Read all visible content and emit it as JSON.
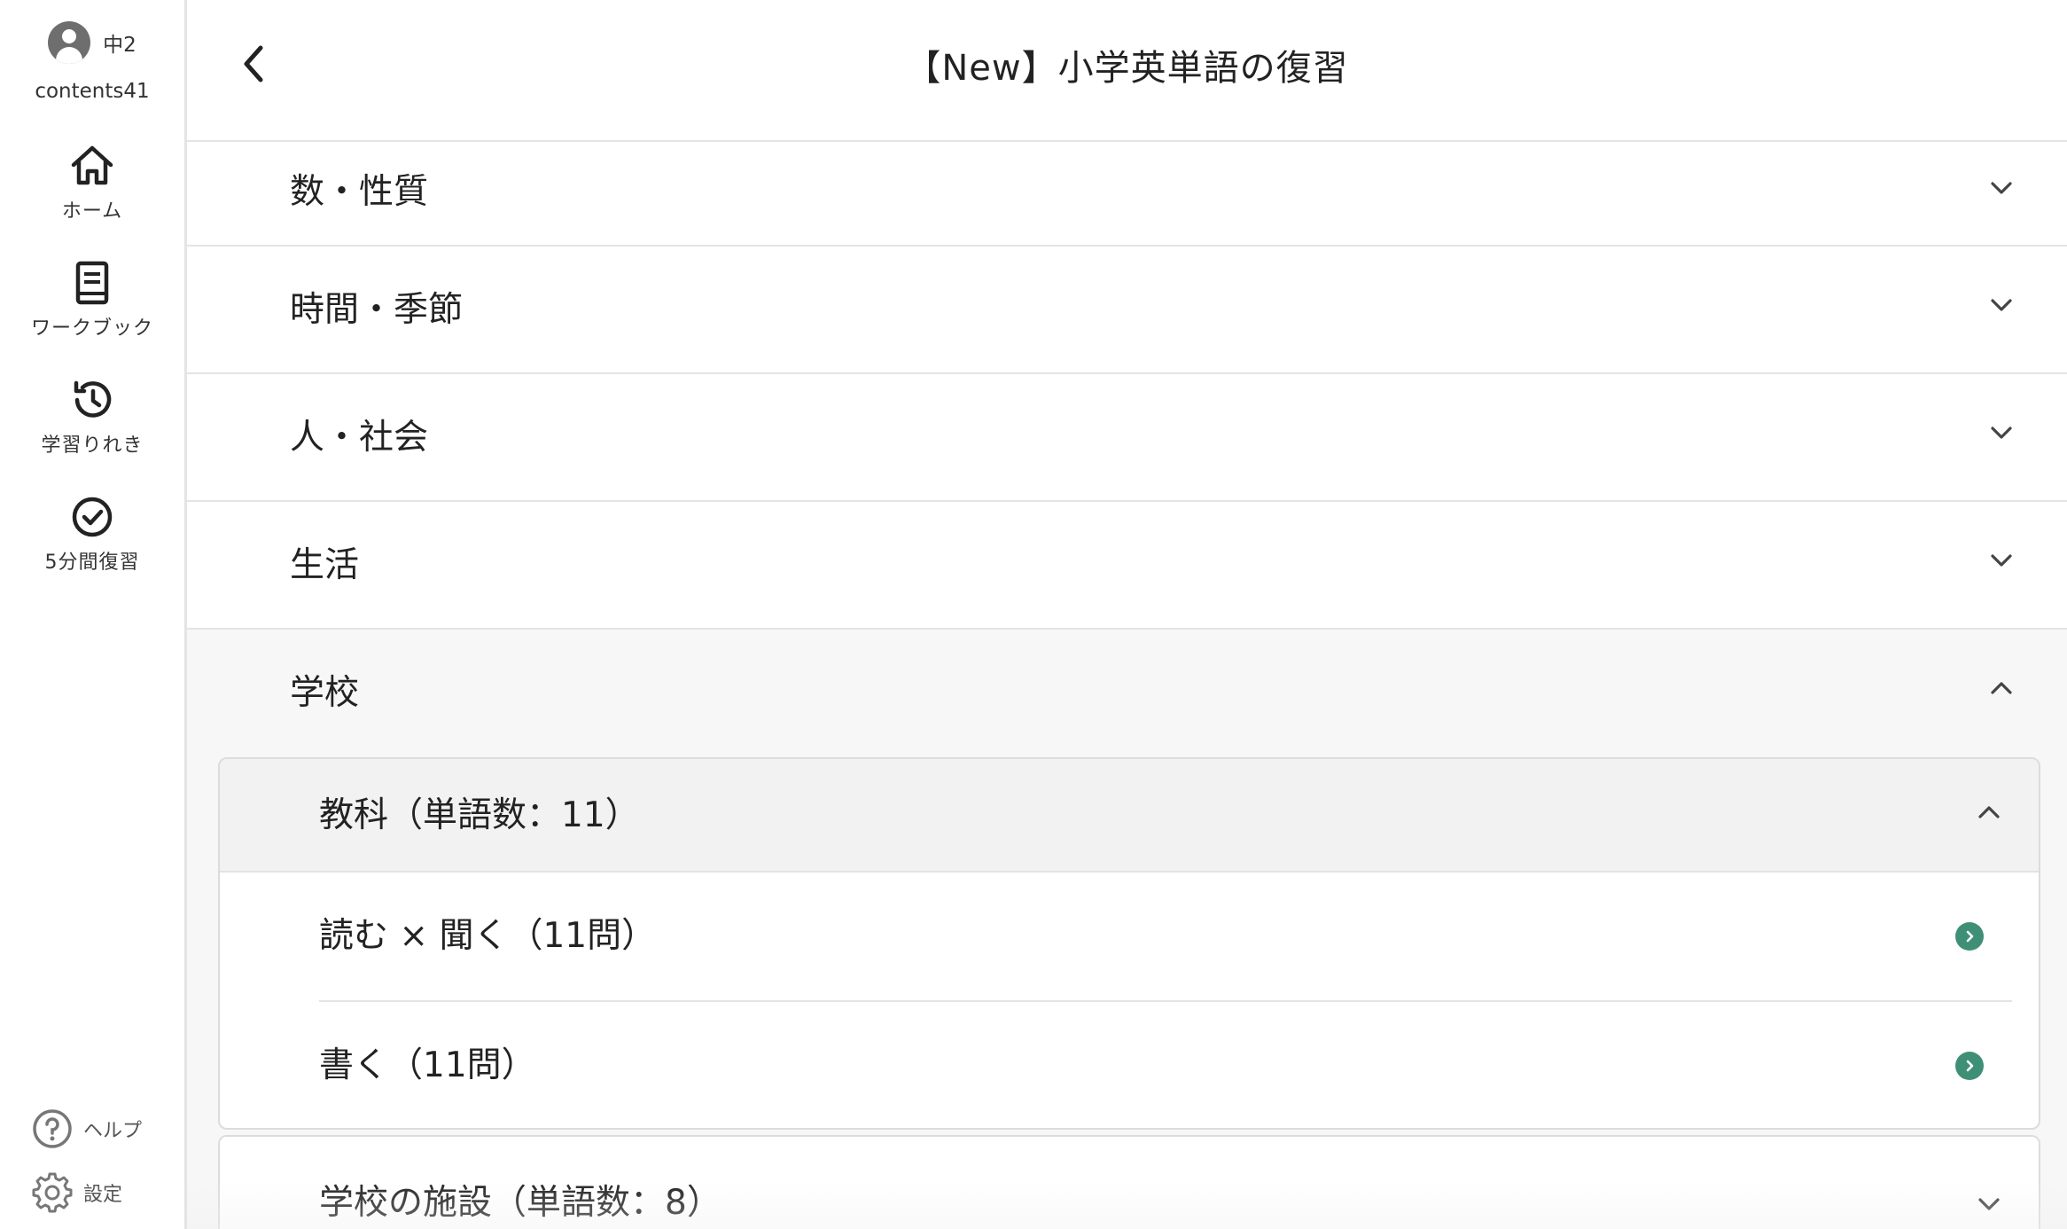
{
  "user": {
    "grade": "中2",
    "username": "contents41"
  },
  "sidebar": {
    "items": [
      {
        "label": "ホーム",
        "icon": "home-icon"
      },
      {
        "label": "ワークブック",
        "icon": "book-icon"
      },
      {
        "label": "学習りれき",
        "icon": "history-icon"
      },
      {
        "label": "5分間復習",
        "icon": "check-circle-icon"
      }
    ],
    "help_label": "ヘルプ",
    "settings_label": "設定"
  },
  "header": {
    "title": "【New】小学英単語の復習"
  },
  "categories": [
    {
      "label": "数・性質",
      "expanded": false
    },
    {
      "label": "時間・季節",
      "expanded": false
    },
    {
      "label": "人・社会",
      "expanded": false
    },
    {
      "label": "生活",
      "expanded": false
    },
    {
      "label": "学校",
      "expanded": true
    }
  ],
  "subcategories": [
    {
      "label": "教科（単語数：11）",
      "expanded": true,
      "items": [
        {
          "label": "読む × 聞く（11問）"
        },
        {
          "label": "書く（11問）"
        }
      ]
    },
    {
      "label": "学校の施設（単語数：8）",
      "expanded": false
    }
  ],
  "colors": {
    "accent": "#3f8f77",
    "divider": "#e4e4e4",
    "expanded_bg": "#f7f7f7"
  }
}
